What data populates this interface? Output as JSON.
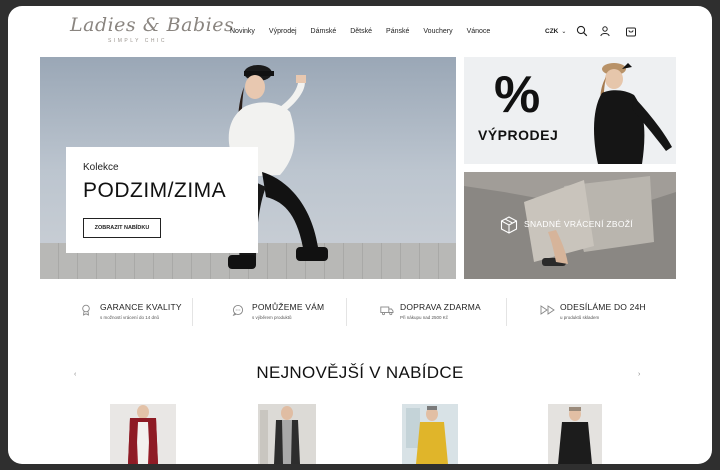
{
  "brand": {
    "name": "Ladies & Babies",
    "tagline": "SIMPLY CHIC"
  },
  "nav": [
    "Novinky",
    "Výprodej",
    "Dámské",
    "Dětské",
    "Pánské",
    "Vouchery",
    "Vánoce"
  ],
  "header": {
    "currency": "CZK",
    "icons": [
      "search-icon",
      "user-icon",
      "cart-icon"
    ]
  },
  "hero": {
    "kicker": "Kolekce",
    "title": "PODZIM/ZIMA",
    "button": "ZOBRAZIT NABÍDKU"
  },
  "tiles": {
    "sale": {
      "symbol": "%",
      "label": "VÝPRODEJ"
    },
    "returns": {
      "label": "SNADNÉ VRÁCENÍ ZBOŽÍ",
      "icon": "box-icon"
    }
  },
  "features": [
    {
      "title": "GARANCE KVALITY",
      "sub": "s možností vrácení do 14 dnů",
      "icon": "quality-icon"
    },
    {
      "title": "POMŮŽEME VÁM",
      "sub": "s výběrem produktů",
      "icon": "chat-icon"
    },
    {
      "title": "DOPRAVA ZDARMA",
      "sub": "Při nákupu nad 2500 Kč",
      "icon": "truck-icon"
    },
    {
      "title": "ODESÍLÁME DO 24H",
      "sub": "u produktů skladem",
      "icon": "fast-forward-icon"
    }
  ],
  "section": {
    "title": "NEJNOVĚJŠÍ V NABÍDCE",
    "prev": "‹",
    "next": "›"
  },
  "colors": {
    "accent": "#222222",
    "returns_tile": "#8a8783",
    "sale_tile": "#eef0f2"
  }
}
